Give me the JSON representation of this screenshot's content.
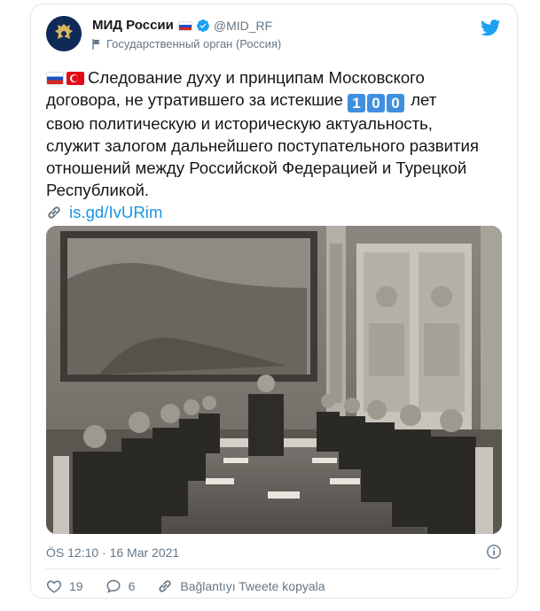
{
  "author": {
    "display_name": "МИД России",
    "handle": "@MID_RF",
    "label": "Государственный орган (Россия)",
    "verified": true
  },
  "tweet": {
    "flags": [
      "flag-russia",
      "flag-turkey"
    ],
    "lines": [
      "Следование духу и принципам Московского",
      "договора, не утратившего за истекшие",
      "лет",
      "свою политическую и историческую актуальность,",
      "служит залогом дальнейшего поступательного развития",
      "отношений между Российской Федерацией и Турецкой",
      "Республикой."
    ],
    "keycap_digits": [
      "1",
      "0",
      "0"
    ],
    "link_text": "is.gd/IvURim"
  },
  "timestamp": "ÖS 12:10 · 16 Mar 2021",
  "actions": {
    "likes": "19",
    "replies": "6",
    "copy_link_label": "Bağlantıyı Tweete kopyala"
  },
  "colors": {
    "link": "#1b95e0",
    "secondary_text": "#657786",
    "border": "#e1e8ed",
    "twitter_blue": "#1da1f2"
  }
}
